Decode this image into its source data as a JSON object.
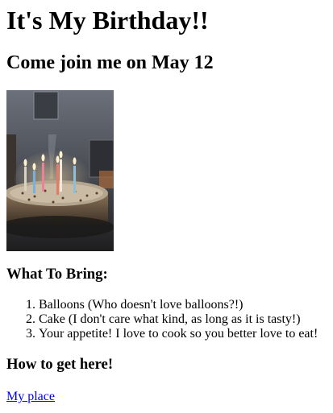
{
  "page": {
    "title": "It's My Birthday!!",
    "subtitle": "Come join me on May 12"
  },
  "image": {
    "icon": "birthday-cake-photo",
    "colors": {
      "background": "#5a5e66",
      "cake": "#6b5a48",
      "frosting": "#b9ab95",
      "flame": "#ffd9a0"
    }
  },
  "bring": {
    "heading": "What To Bring:",
    "items": [
      "Balloons (Who doesn't love balloons?!)",
      "Cake (I don't care what kind, as long as it is tasty!)",
      "Your appetite! I love to cook so you better love to eat!"
    ]
  },
  "directions": {
    "heading": "How to get here!",
    "link_text": "My place",
    "link_color": "#0000ee"
  }
}
